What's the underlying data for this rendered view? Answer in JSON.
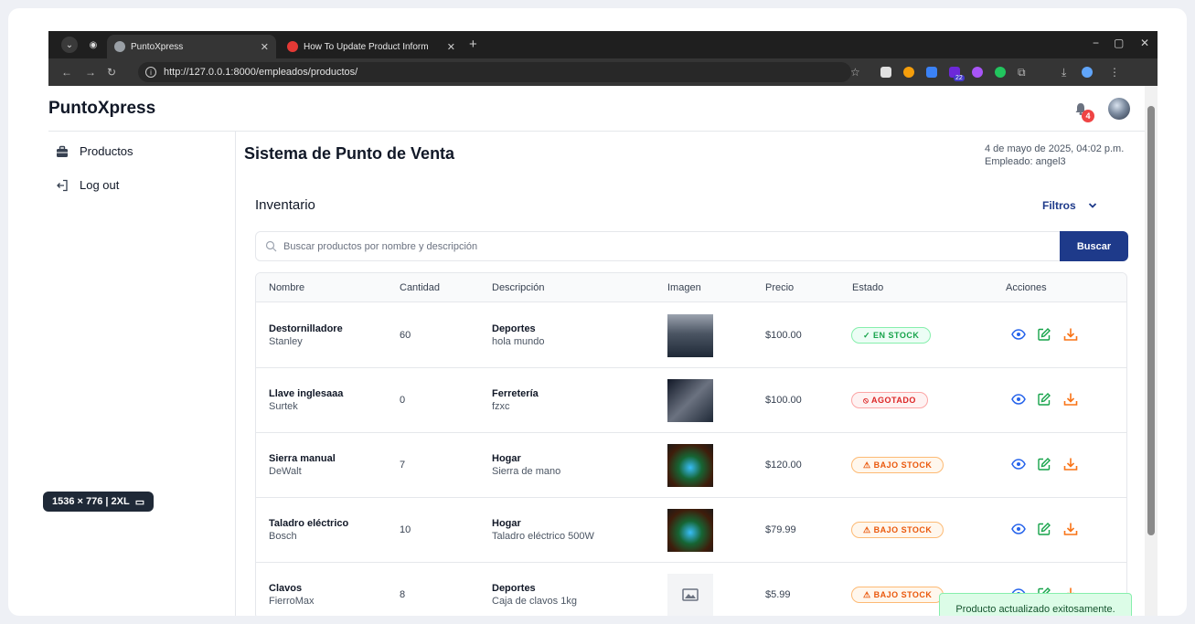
{
  "browser": {
    "tabs": [
      {
        "title": "PuntoXpress",
        "active": true
      },
      {
        "title": "How To Update Product Inform",
        "active": false
      }
    ],
    "url": "http://127.0.0.1:8000/empleados/productos/",
    "extension_badge": "22"
  },
  "app": {
    "brand": "PuntoXpress",
    "notification_count": "4"
  },
  "sidebar": {
    "items": [
      {
        "label": "Productos",
        "icon": "briefcase-icon"
      },
      {
        "label": "Log out",
        "icon": "logout-icon"
      }
    ]
  },
  "devtools_badge": "1536 × 776 | 2XL",
  "main": {
    "title": "Sistema de Punto de Venta",
    "date": "4 de mayo de 2025, 04:02 p.m.",
    "employee": "Empleado: angel3",
    "section_title": "Inventario",
    "filters_label": "Filtros",
    "search_placeholder": "Buscar productos por nombre y descripción",
    "search_button": "Buscar"
  },
  "table": {
    "headers": [
      "Nombre",
      "Cantidad",
      "Descripción",
      "Imagen",
      "Precio",
      "Estado",
      "Acciones"
    ],
    "rows": [
      {
        "name": "Destornilladore",
        "brand": "Stanley",
        "qty": "60",
        "category": "Deportes",
        "desc": "hola mundo",
        "price": "$100.00",
        "status": "✓ EN STOCK",
        "status_type": "ok",
        "image": "misty-forest"
      },
      {
        "name": "Llave inglesaaa",
        "brand": "Surtek",
        "qty": "0",
        "category": "Ferretería",
        "desc": "fzxc",
        "price": "$100.00",
        "status": "⦸ AGOTADO",
        "status_type": "out",
        "image": "dark-figure"
      },
      {
        "name": "Sierra manual",
        "brand": "DeWalt",
        "qty": "7",
        "category": "Hogar",
        "desc": "Sierra de mano",
        "price": "$120.00",
        "status": "⚠ BAJO STOCK",
        "status_type": "low",
        "image": "anime-character"
      },
      {
        "name": "Taladro eléctrico",
        "brand": "Bosch",
        "qty": "10",
        "category": "Hogar",
        "desc": "Taladro eléctrico 500W",
        "price": "$79.99",
        "status": "⚠ BAJO STOCK",
        "status_type": "low",
        "image": "anime-character"
      },
      {
        "name": "Clavos",
        "brand": "FierroMax",
        "qty": "8",
        "category": "Deportes",
        "desc": "Caja de clavos 1kg",
        "price": "$5.99",
        "status": "⚠ BAJO STOCK",
        "status_type": "low",
        "image": "placeholder"
      }
    ]
  },
  "toast": "Producto actualizado exitosamente.",
  "colors": {
    "accent": "#1e3a8a",
    "view": "#2563eb",
    "edit": "#16a34a",
    "download": "#f97316"
  }
}
